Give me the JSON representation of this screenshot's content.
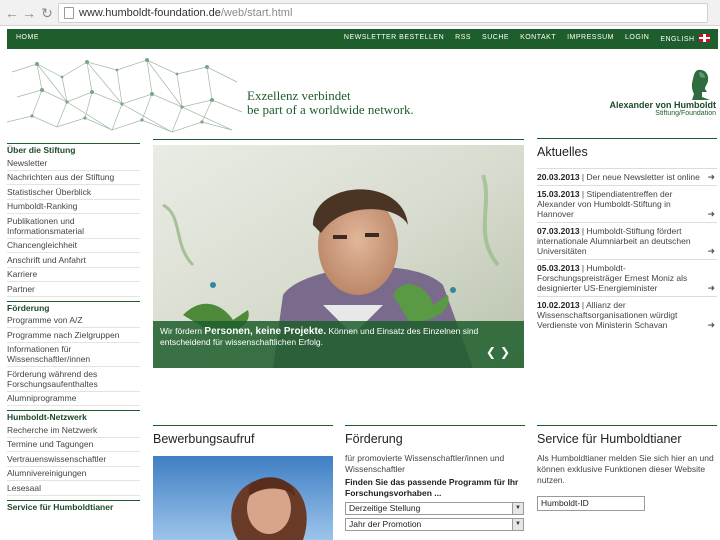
{
  "browser": {
    "url_domain": "www.humboldt-foundation.de",
    "url_path": "/web/start.html"
  },
  "topnav": {
    "home": "HOME",
    "links": [
      "NEWSLETTER BESTELLEN",
      "RSS",
      "SUCHE",
      "KONTAKT",
      "IMPRESSUM",
      "LOGIN",
      "ENGLISH"
    ]
  },
  "banner": {
    "tagline_line1": "Exzellenz verbindet",
    "tagline_line2": "be part of a worldwide network.",
    "logo_name": "Alexander von Humboldt",
    "logo_sub": "Stiftung/Foundation"
  },
  "sidebar": {
    "sections": [
      {
        "title": "Über die Stiftung",
        "items": [
          "Newsletter",
          "Nachrichten aus der Stiftung",
          "Statistischer Überblick",
          "Humboldt-Ranking",
          "Publikationen und Informationsmaterial",
          "Chancengleichheit",
          "Anschrift und Anfahrt",
          "Karriere",
          "Partner"
        ]
      },
      {
        "title": "Förderung",
        "items": [
          "Programme von A/Z",
          "Programme nach Zielgruppen",
          "Informationen für Wissenschaftler/innen",
          "Förderung während des Forschungsaufenthaltes",
          "Alumniprogramme"
        ]
      },
      {
        "title": "Humboldt-Netzwerk",
        "items": [
          "Recherche im Netzwerk",
          "Termine und Tagungen",
          "Vertrauenswissenschaftler",
          "Alumnivereinigungen",
          "Lesesaal"
        ]
      },
      {
        "title": "Service für Humboldtianer",
        "items": []
      }
    ]
  },
  "hero": {
    "caption_prefix": "Wir fördern ",
    "caption_bold": "Personen, keine Projekte.",
    "caption_rest": " Können und Einsatz des Einzelnen sind entscheidend für wissenschaftlichen Erfolg."
  },
  "news": {
    "title": "Aktuelles",
    "items": [
      {
        "date": "20.03.2013",
        "text": " | Der neue Newsletter ist online"
      },
      {
        "date": "15.03.2013",
        "text": " | Stipendiatentreffen der Alexander von Humboldt-Stiftung in Hannover"
      },
      {
        "date": "07.03.2013",
        "text": " | Humboldt-Stiftung fördert internationale Alumniarbeit an deutschen Universitäten"
      },
      {
        "date": "05.03.2013",
        "text": " | Humboldt-Forschungspreisträger Ernest Moniz als designierter US-Energieminister"
      },
      {
        "date": "10.02.2013",
        "text": " | Allianz der Wissenschaftsorganisationen würdigt Verdienste von Ministerin Schavan"
      }
    ]
  },
  "bewerbung": {
    "title": "Bewerbungsaufruf"
  },
  "foerderung": {
    "title": "Förderung",
    "text": "für promovierte Wissenschaftler/innen und Wissenschaftler",
    "bold": "Finden Sie das passende Programm für Ihr Forschungsvorhaben ...",
    "select1": "Derzeitige Stellung",
    "select2": "Jahr der Promotion"
  },
  "service": {
    "title": "Service für Humboldtianer",
    "text": "Als Humboldtianer melden Sie sich hier an und können exklusive Funktionen dieser Website nutzen.",
    "id_placeholder": "Humboldt-ID"
  },
  "colors": {
    "brand_green": "#1d5e2c"
  }
}
